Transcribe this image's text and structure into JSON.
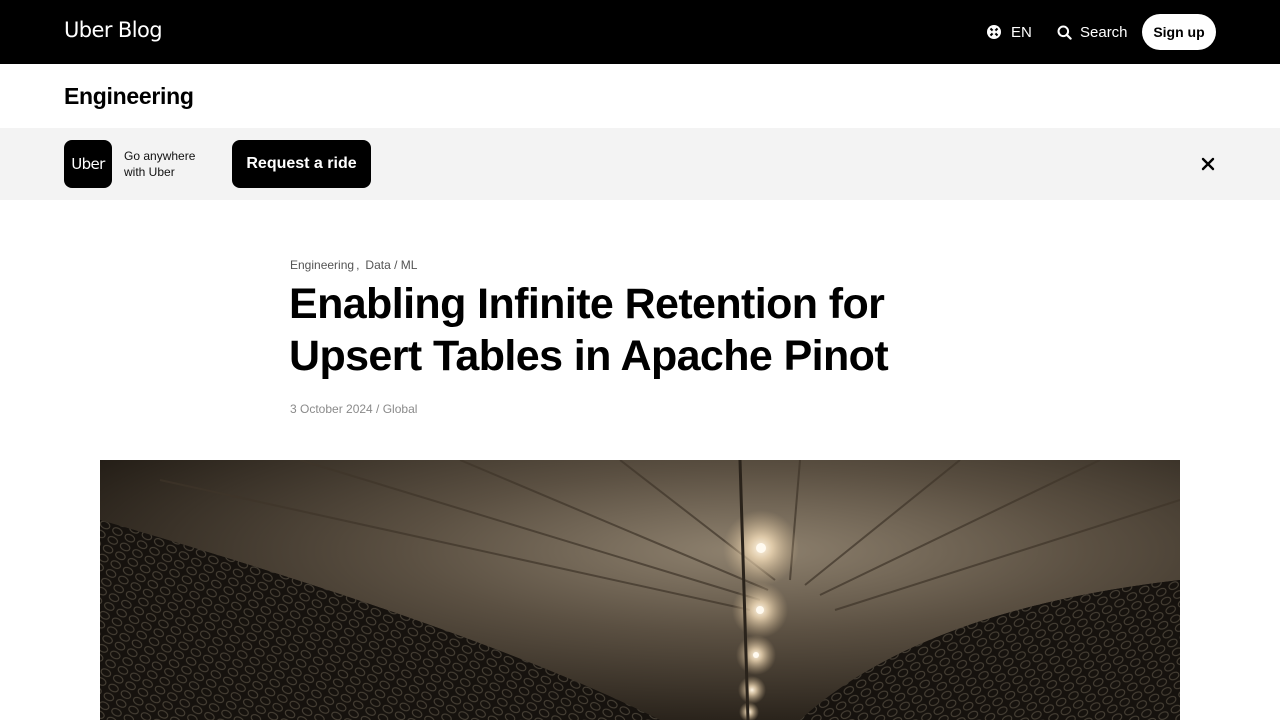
{
  "header": {
    "logo": "Uber Blog",
    "lang_label": "EN",
    "search_label": "Search",
    "signup_label": "Sign up"
  },
  "section": {
    "title": "Engineering"
  },
  "promo": {
    "app_icon_text": "Uber",
    "tagline": "Go anywhere with Uber",
    "cta_label": "Request a ride"
  },
  "article": {
    "tags": [
      "Engineering",
      "Data / ML"
    ],
    "tag_separator": ",",
    "title": "Enabling Infinite Retention for Upsert Tables in Apache Pinot",
    "meta": "3 October 2024 / Global"
  },
  "icons": {
    "lang": "globe-icon",
    "search": "search-icon",
    "close": "close-icon"
  },
  "colors": {
    "nav_bg": "#000000",
    "promo_bg": "#f3f3f3",
    "accent": "#000000"
  }
}
